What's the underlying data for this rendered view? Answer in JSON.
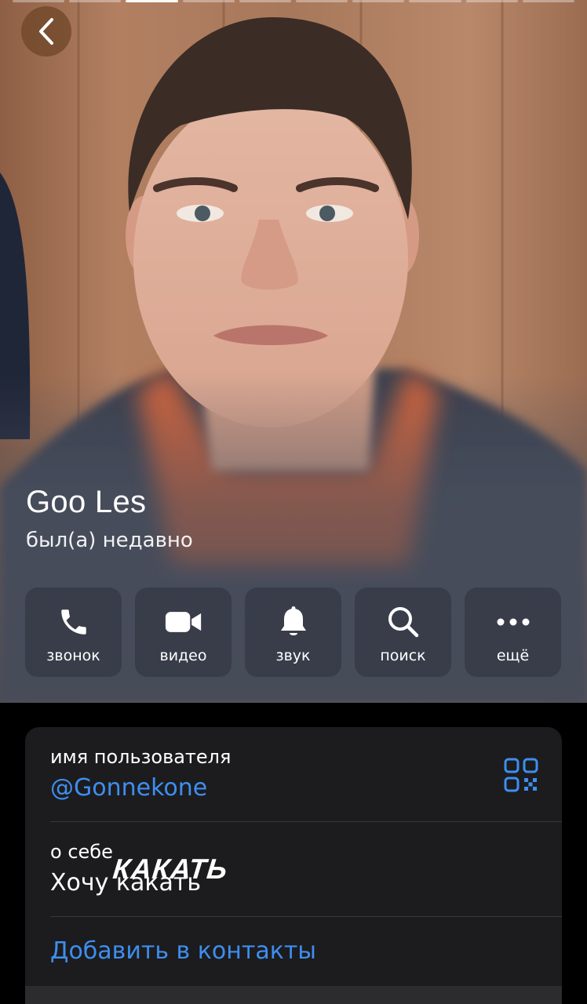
{
  "story": {
    "segment_count": 10,
    "active_index": 2
  },
  "profile": {
    "name": "Goo Les",
    "status": "был(а) недавно"
  },
  "actions": [
    {
      "id": "call",
      "label": "звонок",
      "icon": "phone-icon"
    },
    {
      "id": "video",
      "label": "видео",
      "icon": "video-camera-icon"
    },
    {
      "id": "sound",
      "label": "звук",
      "icon": "bell-icon"
    },
    {
      "id": "search",
      "label": "поиск",
      "icon": "search-icon"
    },
    {
      "id": "more",
      "label": "ещё",
      "icon": "more-dots-icon"
    }
  ],
  "info": {
    "username_caption": "имя пользователя",
    "username_value": "@Gonnekone",
    "about_caption": "о себе",
    "about_value": "Хочу какать",
    "about_sticker": "КАКАТЬ",
    "add_contact": "Добавить в контакты"
  },
  "colors": {
    "accent": "#3e8ef0",
    "card_background": "#1c1c1e",
    "page_background": "#000000"
  }
}
